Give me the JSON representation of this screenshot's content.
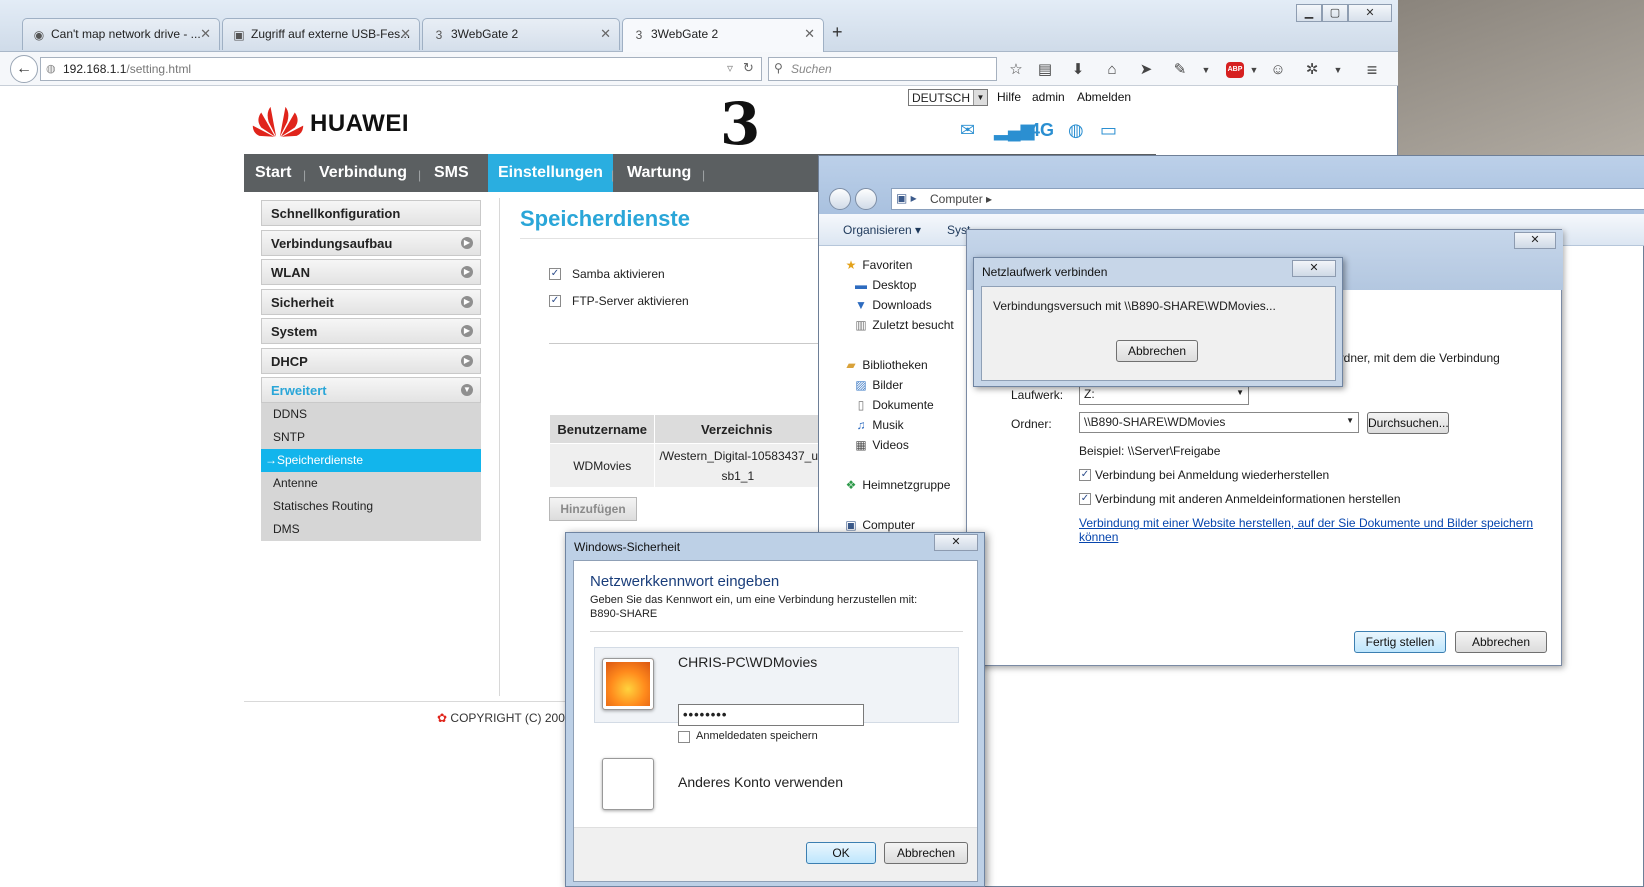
{
  "browser": {
    "tabs": [
      {
        "label": "Can't map network drive - ...",
        "icon": "chrome-icon"
      },
      {
        "label": "Zugriff auf externe USB-Fes...",
        "icon": "site-icon"
      },
      {
        "label": "3WebGate 2",
        "icon": "three-icon"
      },
      {
        "label": "3WebGate 2",
        "icon": "three-icon"
      }
    ],
    "new_tab": "+",
    "url_host": "192.168.1.1",
    "url_path": "/setting.html",
    "search_placeholder": "Suchen",
    "window_min": "▁",
    "window_max": "▢",
    "window_close": "✕"
  },
  "router": {
    "brand": "HUAWEI",
    "operator": "3",
    "language": "DEUTSCH",
    "top_links": {
      "help": "Hilfe",
      "user": "admin",
      "logout": "Abmelden"
    },
    "network_type": "4G",
    "nav": [
      "Start",
      "Verbindung",
      "SMS",
      "Einstellungen",
      "Wartung"
    ],
    "nav_active": "Einstellungen",
    "sidebar": [
      {
        "label": "Schnellkonfiguration"
      },
      {
        "label": "Verbindungsaufbau"
      },
      {
        "label": "WLAN"
      },
      {
        "label": "Sicherheit"
      },
      {
        "label": "System"
      },
      {
        "label": "DHCP"
      },
      {
        "label": "Erweitert"
      }
    ],
    "submenu": [
      "DDNS",
      "SNTP",
      "→Speicherdienste",
      "Antenne",
      "Statisches Routing",
      "DMS"
    ],
    "page_title": "Speicherdienste",
    "options": [
      {
        "label": "Samba aktivieren",
        "checked": true
      },
      {
        "label": "FTP-Server aktivieren",
        "checked": true
      }
    ],
    "table": {
      "headers": [
        "Benutzername",
        "Verzeichnis"
      ],
      "rows": [
        {
          "user": "WDMovies",
          "dir_line1": "/Western_Digital-10583437_u",
          "dir_line2": "sb1_1"
        }
      ]
    },
    "add_button": "Hinzufügen",
    "copyright": "COPYRIGHT (C) 200"
  },
  "explorer": {
    "breadcrumb": "Computer",
    "toolbar": {
      "organize": "Organisieren ▾",
      "system": "Syst"
    },
    "nav": {
      "favorites": "Favoriten",
      "desktop": "Desktop",
      "downloads": "Downloads",
      "recent": "Zuletzt besucht",
      "libraries": "Bibliotheken",
      "pictures": "Bilder",
      "documents": "Dokumente",
      "music": "Musik",
      "videos": "Videos",
      "homegroup": "Heimnetzgruppe",
      "computer": "Computer"
    }
  },
  "mapdrive": {
    "close": "✕",
    "desc_partial": "den Ordner, mit dem die Verbindung",
    "drive_label": "Laufwerk:",
    "drive_value": "Z:",
    "folder_label": "Ordner:",
    "folder_value": "\\\\B890-SHARE\\WDMovies",
    "browse": "Durchsuchen...",
    "example": "Beispiel: \\\\Server\\Freigabe",
    "reconnect": "Verbindung bei Anmeldung wiederherstellen",
    "other_creds": "Verbindung mit anderen Anmeldeinformationen herstellen",
    "website_link1": "Verbindung mit einer Website herstellen, auf der Sie Dokumente und Bilder speichern",
    "website_link2": "können",
    "finish": "Fertig stellen",
    "cancel": "Abbrechen"
  },
  "connecting": {
    "title": "Netzlaufwerk verbinden",
    "message": "Verbindungsversuch mit \\\\B890-SHARE\\WDMovies...",
    "cancel": "Abbrechen",
    "close": "✕"
  },
  "security": {
    "title": "Windows-Sicherheit",
    "close": "✕",
    "heading": "Netzwerkkennwort eingeben",
    "desc1": "Geben Sie das Kennwort ein, um eine Verbindung herzustellen mit:",
    "desc2": "B890-SHARE",
    "account": "CHRIS-PC\\WDMovies",
    "password_mask": "••••••••",
    "remember": "Anmeldedaten speichern",
    "other_account": "Anderes Konto verwenden",
    "ok": "OK",
    "cancel": "Abbrechen"
  }
}
